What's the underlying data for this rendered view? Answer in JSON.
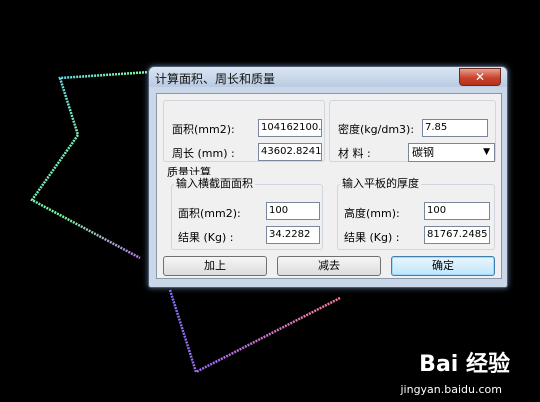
{
  "window": {
    "title": "计算面积、周长和质量",
    "close_glyph": "✕"
  },
  "top": {
    "area_label": "面积(mm2):",
    "area_value": "104162100.",
    "perimeter_label": "周长 (mm) :",
    "perimeter_value": "43602.8241",
    "density_label": "密度(kg/dm3):",
    "density_value": "7.85",
    "material_label": "材 料 :",
    "material_value": "碳钢"
  },
  "mass": {
    "title": "质量计算",
    "left": {
      "title": "输入横截面面积",
      "input_label": "面积(mm2):",
      "input_value": "100",
      "result_label": "结果 (Kg) :",
      "result_value": "34.2282"
    },
    "right": {
      "title": "输入平板的厚度",
      "input_label": "高度(mm):",
      "input_value": "100",
      "result_label": "结果 (Kg) :",
      "result_value": "81767.2485"
    }
  },
  "buttons": {
    "add": "加上",
    "subtract": "减去",
    "ok": "确定"
  },
  "watermark": {
    "logo": "Bai 经验",
    "url": "jingyan.baidu.com"
  }
}
